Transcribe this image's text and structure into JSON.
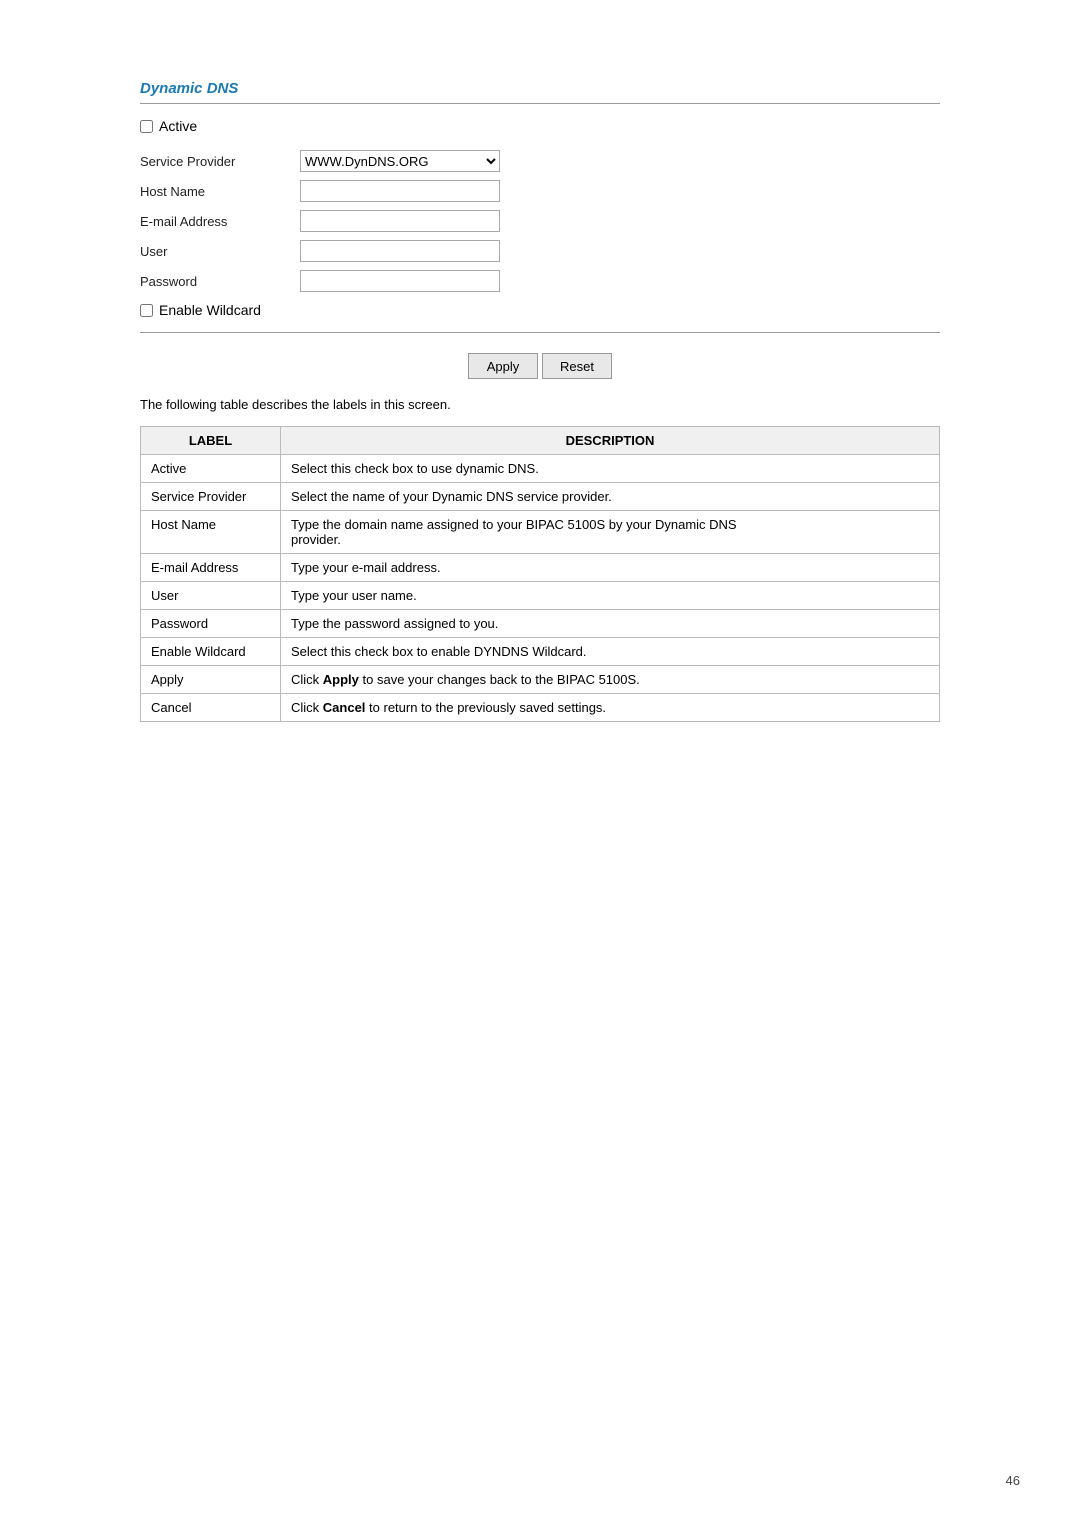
{
  "page": {
    "title": "Dynamic DNS",
    "description": "The following table describes the labels in this screen.",
    "page_number": "46"
  },
  "form": {
    "active_label": "Active",
    "service_provider_label": "Service Provider",
    "service_provider_value": "WWW.DynDNS.ORG",
    "service_provider_options": [
      "WWW.DynDNS.ORG"
    ],
    "host_name_label": "Host Name",
    "email_label": "E-mail Address",
    "user_label": "User",
    "password_label": "Password",
    "enable_wildcard_label": "Enable Wildcard",
    "apply_button": "Apply",
    "reset_button": "Reset"
  },
  "table": {
    "col_label": "LABEL",
    "col_description": "DESCRIPTION",
    "rows": [
      {
        "label": "Active",
        "description": "Select this check box to use dynamic DNS."
      },
      {
        "label": "Service Provider",
        "description": "Select the name of your Dynamic DNS service provider."
      },
      {
        "label": "Host Name",
        "description": "Type the domain name assigned to your BIPAC 5100S by your Dynamic DNS provider.",
        "description2": ""
      },
      {
        "label": "E-mail Address",
        "description": "Type your e-mail address."
      },
      {
        "label": "User",
        "description": "Type your user name."
      },
      {
        "label": "Password",
        "description": "Type the password assigned to you."
      },
      {
        "label": "Enable Wildcard",
        "description": "Select this check box to enable DYNDNS Wildcard."
      },
      {
        "label": "Apply",
        "description_pre": "Click ",
        "description_bold": "Apply",
        "description_post": " to save your changes back to the BIPAC 5100S."
      },
      {
        "label": "Cancel",
        "description_pre": "Click ",
        "description_bold": "Cancel",
        "description_post": " to return to the previously saved settings."
      }
    ]
  }
}
